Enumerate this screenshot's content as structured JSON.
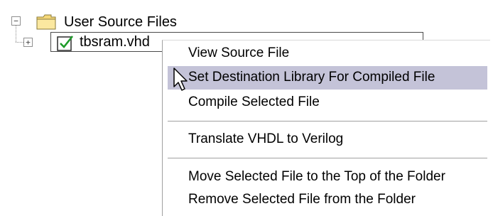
{
  "tree": {
    "root": {
      "label": "User Source Files",
      "expander": "−",
      "icon": "folder-icon"
    },
    "child": {
      "label": "tbsram.vhd",
      "expander": "+",
      "icon": "checked-file-icon"
    }
  },
  "context_menu": {
    "items": [
      {
        "label": "View Source File"
      },
      {
        "label": "Set Destination Library For Compiled File"
      },
      {
        "label": "Compile Selected File"
      },
      {
        "label": "Translate VHDL to Verilog"
      },
      {
        "label": "Move Selected File to the Top of the Folder"
      },
      {
        "label": "Remove Selected File from the Folder"
      }
    ],
    "highlight_color": "#c4c3d8"
  }
}
